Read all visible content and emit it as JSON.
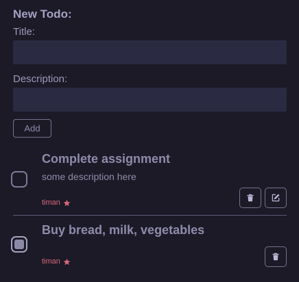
{
  "form": {
    "heading": "New Todo:",
    "title_label": "Title:",
    "title_value": "",
    "description_label": "Description:",
    "description_value": "",
    "add_label": "Add"
  },
  "todos": [
    {
      "title": "Complete assignment",
      "description": "some description here",
      "author": "timan",
      "completed": false,
      "actions": [
        "trash-icon",
        "edit-icon"
      ]
    },
    {
      "title": "Buy bread, milk, vegetables",
      "description": "",
      "author": "timan",
      "completed": true,
      "actions": [
        "trash-icon"
      ]
    }
  ],
  "colors": {
    "background": "#1c1a27",
    "input_background": "#2a2a43",
    "text": "#8e8cab",
    "author": "#d9687c"
  }
}
